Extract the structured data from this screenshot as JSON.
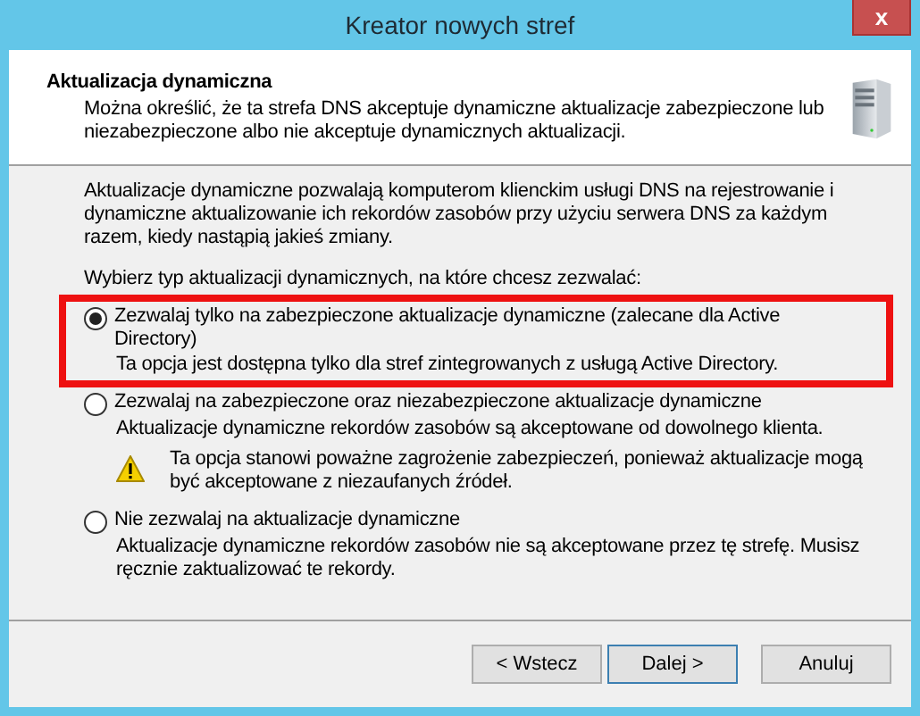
{
  "window": {
    "title": "Kreator nowych stref",
    "close": "x"
  },
  "header": {
    "title": "Aktualizacja dynamiczna",
    "description": "Można określić, że ta strefa DNS akceptuje dynamiczne aktualizacje zabezpieczone lub niezabezpieczone albo nie akceptuje dynamicznych aktualizacji."
  },
  "intro": "Aktualizacje dynamiczne pozwalają komputerom klienckim usługi DNS na rejestrowanie i dynamiczne aktualizowanie ich rekordów zasobów przy użyciu serwera DNS za każdym razem, kiedy nastąpią jakieś zmiany.",
  "prompt": "Wybierz typ aktualizacji dynamicznych, na które chcesz zezwalać:",
  "options": [
    {
      "label": "Zezwalaj tylko na zabezpieczone aktualizacje dynamiczne (zalecane dla Active Directory)",
      "selected": true,
      "highlighted": true,
      "description": "Ta opcja jest dostępna tylko dla stref zintegrowanych z usługą Active Directory."
    },
    {
      "label": "Zezwalaj na zabezpieczone oraz niezabezpieczone aktualizacje dynamiczne",
      "selected": false,
      "highlighted": false,
      "description": "Aktualizacje dynamiczne rekordów zasobów są akceptowane od dowolnego klienta.",
      "warning": "Ta opcja stanowi poważne zagrożenie zabezpieczeń, ponieważ aktualizacje mogą być akceptowane z niezaufanych źródeł."
    },
    {
      "label": "Nie zezwalaj na aktualizacje dynamiczne",
      "selected": false,
      "highlighted": false,
      "description": "Aktualizacje dynamiczne rekordów zasobów nie są akceptowane przez tę strefę. Musisz ręcznie zaktualizować te rekordy."
    }
  ],
  "buttons": [
    {
      "label": "< Wstecz",
      "default": false
    },
    {
      "label": "Dalej >",
      "default": true
    },
    {
      "label": "Anuluj",
      "default": false
    }
  ]
}
